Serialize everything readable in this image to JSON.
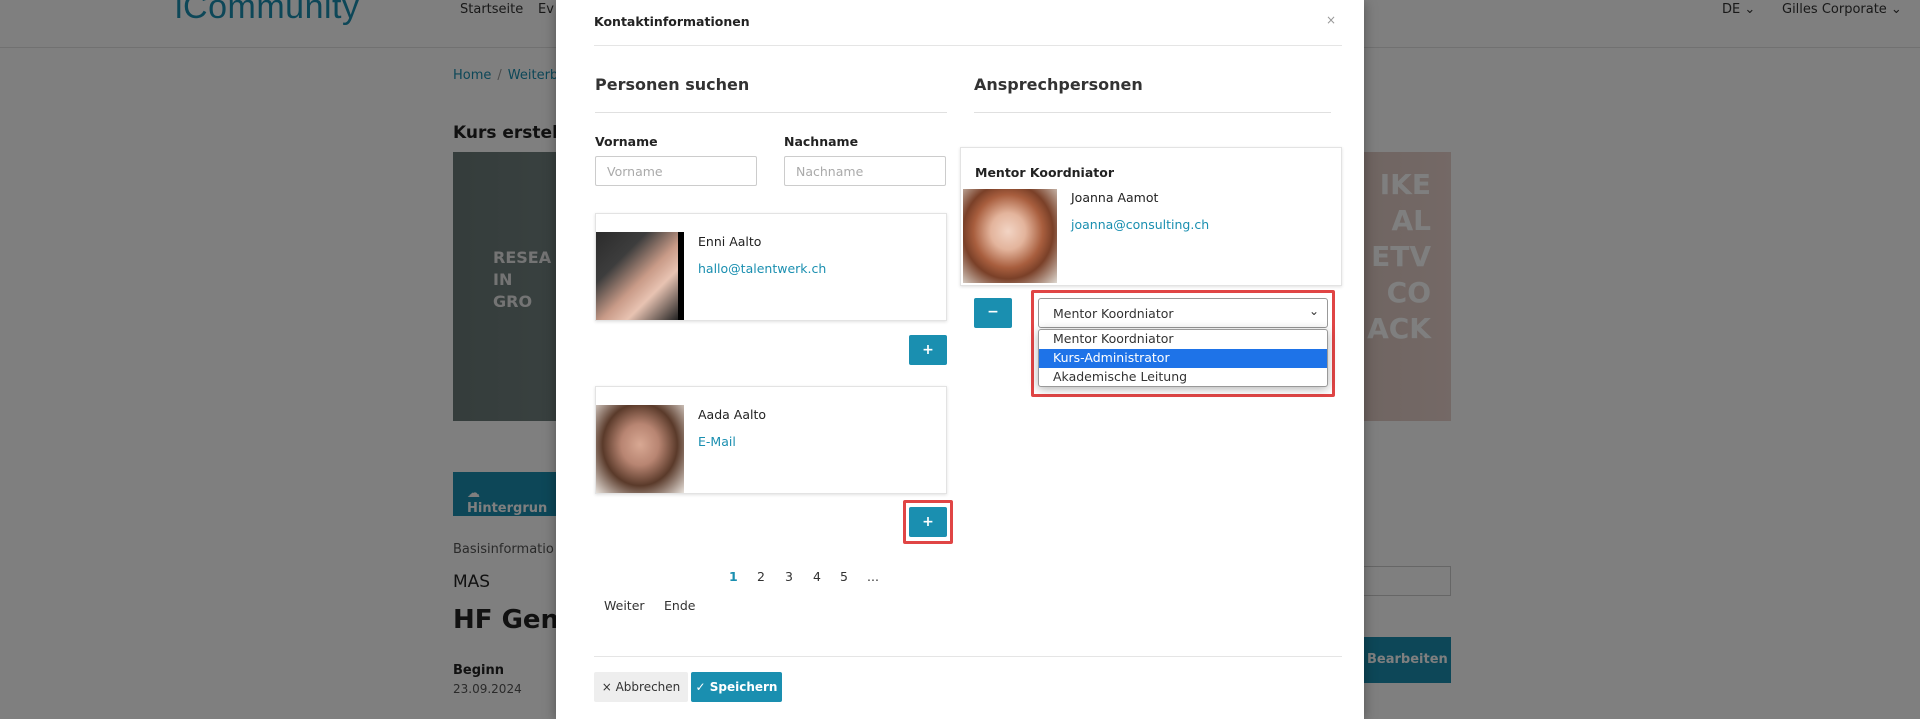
{
  "background": {
    "logo": "iCommunity",
    "nav": [
      "Startseite",
      "Ev"
    ],
    "lang": "DE ⌄",
    "user": "Gilles Corporate ⌄",
    "breadcrumb": [
      "Home",
      "Weiterb"
    ],
    "page_heading": "Kurs erstelle",
    "banner_left": "RESEA\nIN\nGRO",
    "banner_right": "IKE\nAL\nETV\nCO\nACK",
    "upload_button": "Hintergrun",
    "basis_label": "Basisinformatio",
    "mas": "MAS",
    "course_title": "HF Gene",
    "beginn_label": "Beginn",
    "beginn_date": "23.09.2024",
    "edit_button": "Bearbeiten"
  },
  "modal": {
    "title": "Kontaktinformationen",
    "close": "×",
    "search": {
      "title": "Personen suchen",
      "firstname_label": "Vorname",
      "firstname_placeholder": "Vorname",
      "lastname_label": "Nachname",
      "lastname_placeholder": "Nachname"
    },
    "results": [
      {
        "name": "Enni Aalto",
        "email": "hallo@talentwerk.ch",
        "add": "+"
      },
      {
        "name": "Aada Aalto",
        "email": "E-Mail",
        "add": "+"
      }
    ],
    "pagination": {
      "pages": [
        "1",
        "2",
        "3",
        "4",
        "5",
        "..."
      ],
      "active": "1",
      "next": "Weiter",
      "end": "Ende"
    },
    "contacts": {
      "title": "Ansprechpersonen",
      "role": "Mentor Koordniator",
      "name": "Joanna Aamot",
      "email": "joanna@consulting.ch",
      "remove": "−",
      "select_value": "Mentor Koordniator",
      "options": [
        "Mentor Koordniator",
        "Kurs-Administrator",
        "Akademische Leitung"
      ],
      "highlighted_option": "Kurs-Administrator"
    },
    "footer": {
      "cancel": "× Abbrechen",
      "save": "✓ Speichern"
    }
  },
  "colors": {
    "accent": "#1a8fb0",
    "highlight": "#e04545",
    "selection": "#1e73e8"
  }
}
